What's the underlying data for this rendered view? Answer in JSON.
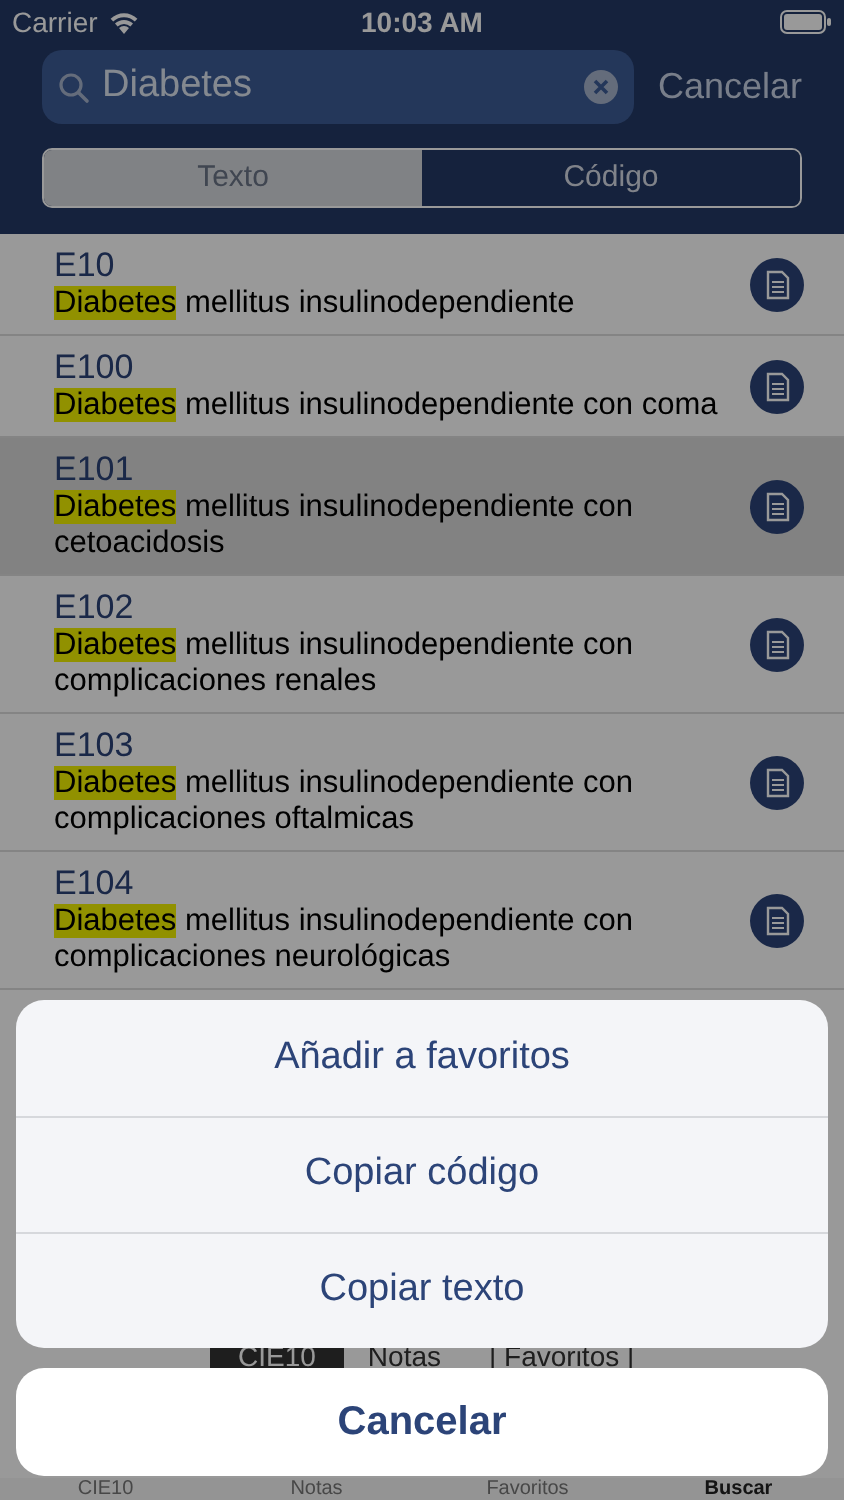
{
  "status_bar": {
    "carrier": "Carrier",
    "time": "10:03 AM"
  },
  "search": {
    "value": "Diabetes",
    "cancel": "Cancelar"
  },
  "segments": [
    {
      "label": "Texto",
      "selected": true
    },
    {
      "label": "Código",
      "selected": false
    }
  ],
  "results": [
    {
      "code": "E10",
      "highlight": "Diabetes",
      "description": "mellitus insulinodependiente",
      "selected": false
    },
    {
      "code": "E100",
      "highlight": "Diabetes",
      "description": "mellitus insulinodependiente con coma",
      "selected": false
    },
    {
      "code": "E101",
      "highlight": "Diabetes",
      "description": "mellitus insulinodependiente con cetoacidosis",
      "selected": true
    },
    {
      "code": "E102",
      "highlight": "Diabetes",
      "description": "mellitus insulinodependiente con complicaciones renales",
      "selected": false
    },
    {
      "code": "E103",
      "highlight": "Diabetes",
      "description": "mellitus insulinodependiente con complicaciones oftalmicas",
      "selected": false
    },
    {
      "code": "E104",
      "highlight": "Diabetes",
      "description": "mellitus insulinodependiente con complicaciones neurológicas",
      "selected": false
    }
  ],
  "bottom_segments": [
    {
      "label": "CIE10",
      "selected": true
    },
    {
      "label": "Notas",
      "selected": false
    },
    {
      "label": "| Favoritos |",
      "selected": false
    }
  ],
  "tab_bar": [
    {
      "label": "CIE10",
      "selected": false
    },
    {
      "label": "Notas",
      "selected": false
    },
    {
      "label": "Favoritos",
      "selected": false
    },
    {
      "label": "Buscar",
      "selected": true
    }
  ],
  "action_sheet": {
    "actions": [
      "Añadir a favoritos",
      "Copiar código",
      "Copiar texto"
    ],
    "cancel": "Cancelar"
  }
}
